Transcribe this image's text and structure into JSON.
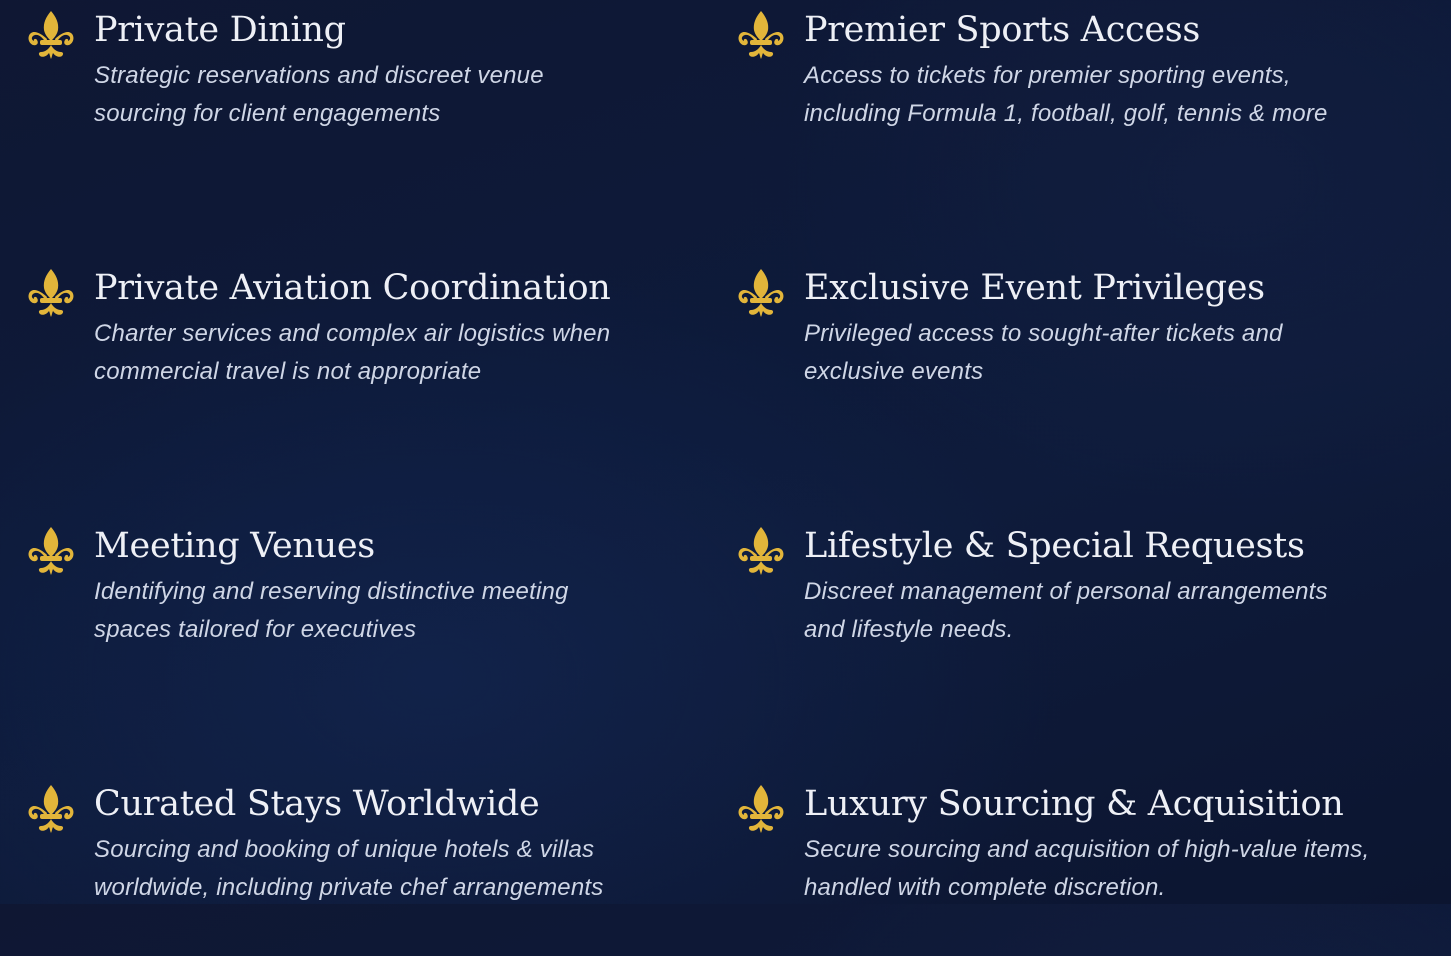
{
  "icon": {
    "name": "fleur-de-lis-icon",
    "color": "#e2b53a"
  },
  "services": [
    {
      "title": "Private Dining",
      "desc_line1": "Strategic reservations and discreet venue",
      "desc_line2": "sourcing for client engagements"
    },
    {
      "title": "Premier Sports Access",
      "desc_line1": "Access to tickets for premier sporting events,",
      "desc_line2": "including Formula 1, football, golf, tennis & more"
    },
    {
      "title": "Private Aviation Coordination",
      "desc_line1": "Charter services and complex air logistics when",
      "desc_line2": "commercial travel is not appropriate"
    },
    {
      "title": "Exclusive Event Privileges",
      "desc_line1": "Privileged access to sought-after tickets and",
      "desc_line2": "exclusive events"
    },
    {
      "title": "Meeting Venues",
      "desc_line1": "Identifying and reserving distinctive meeting",
      "desc_line2": "spaces tailored for executives"
    },
    {
      "title": "Lifestyle & Special Requests",
      "desc_line1": "Discreet management of personal arrangements",
      "desc_line2": "and lifestyle needs."
    },
    {
      "title": "Curated Stays Worldwide",
      "desc_line1": "Sourcing and booking of unique hotels & villas",
      "desc_line2": "worldwide, including private chef arrangements"
    },
    {
      "title": "Luxury Sourcing & Acquisition",
      "desc_line1": "Secure sourcing and acquisition of high-value items,",
      "desc_line2": "handled with complete discretion."
    }
  ]
}
